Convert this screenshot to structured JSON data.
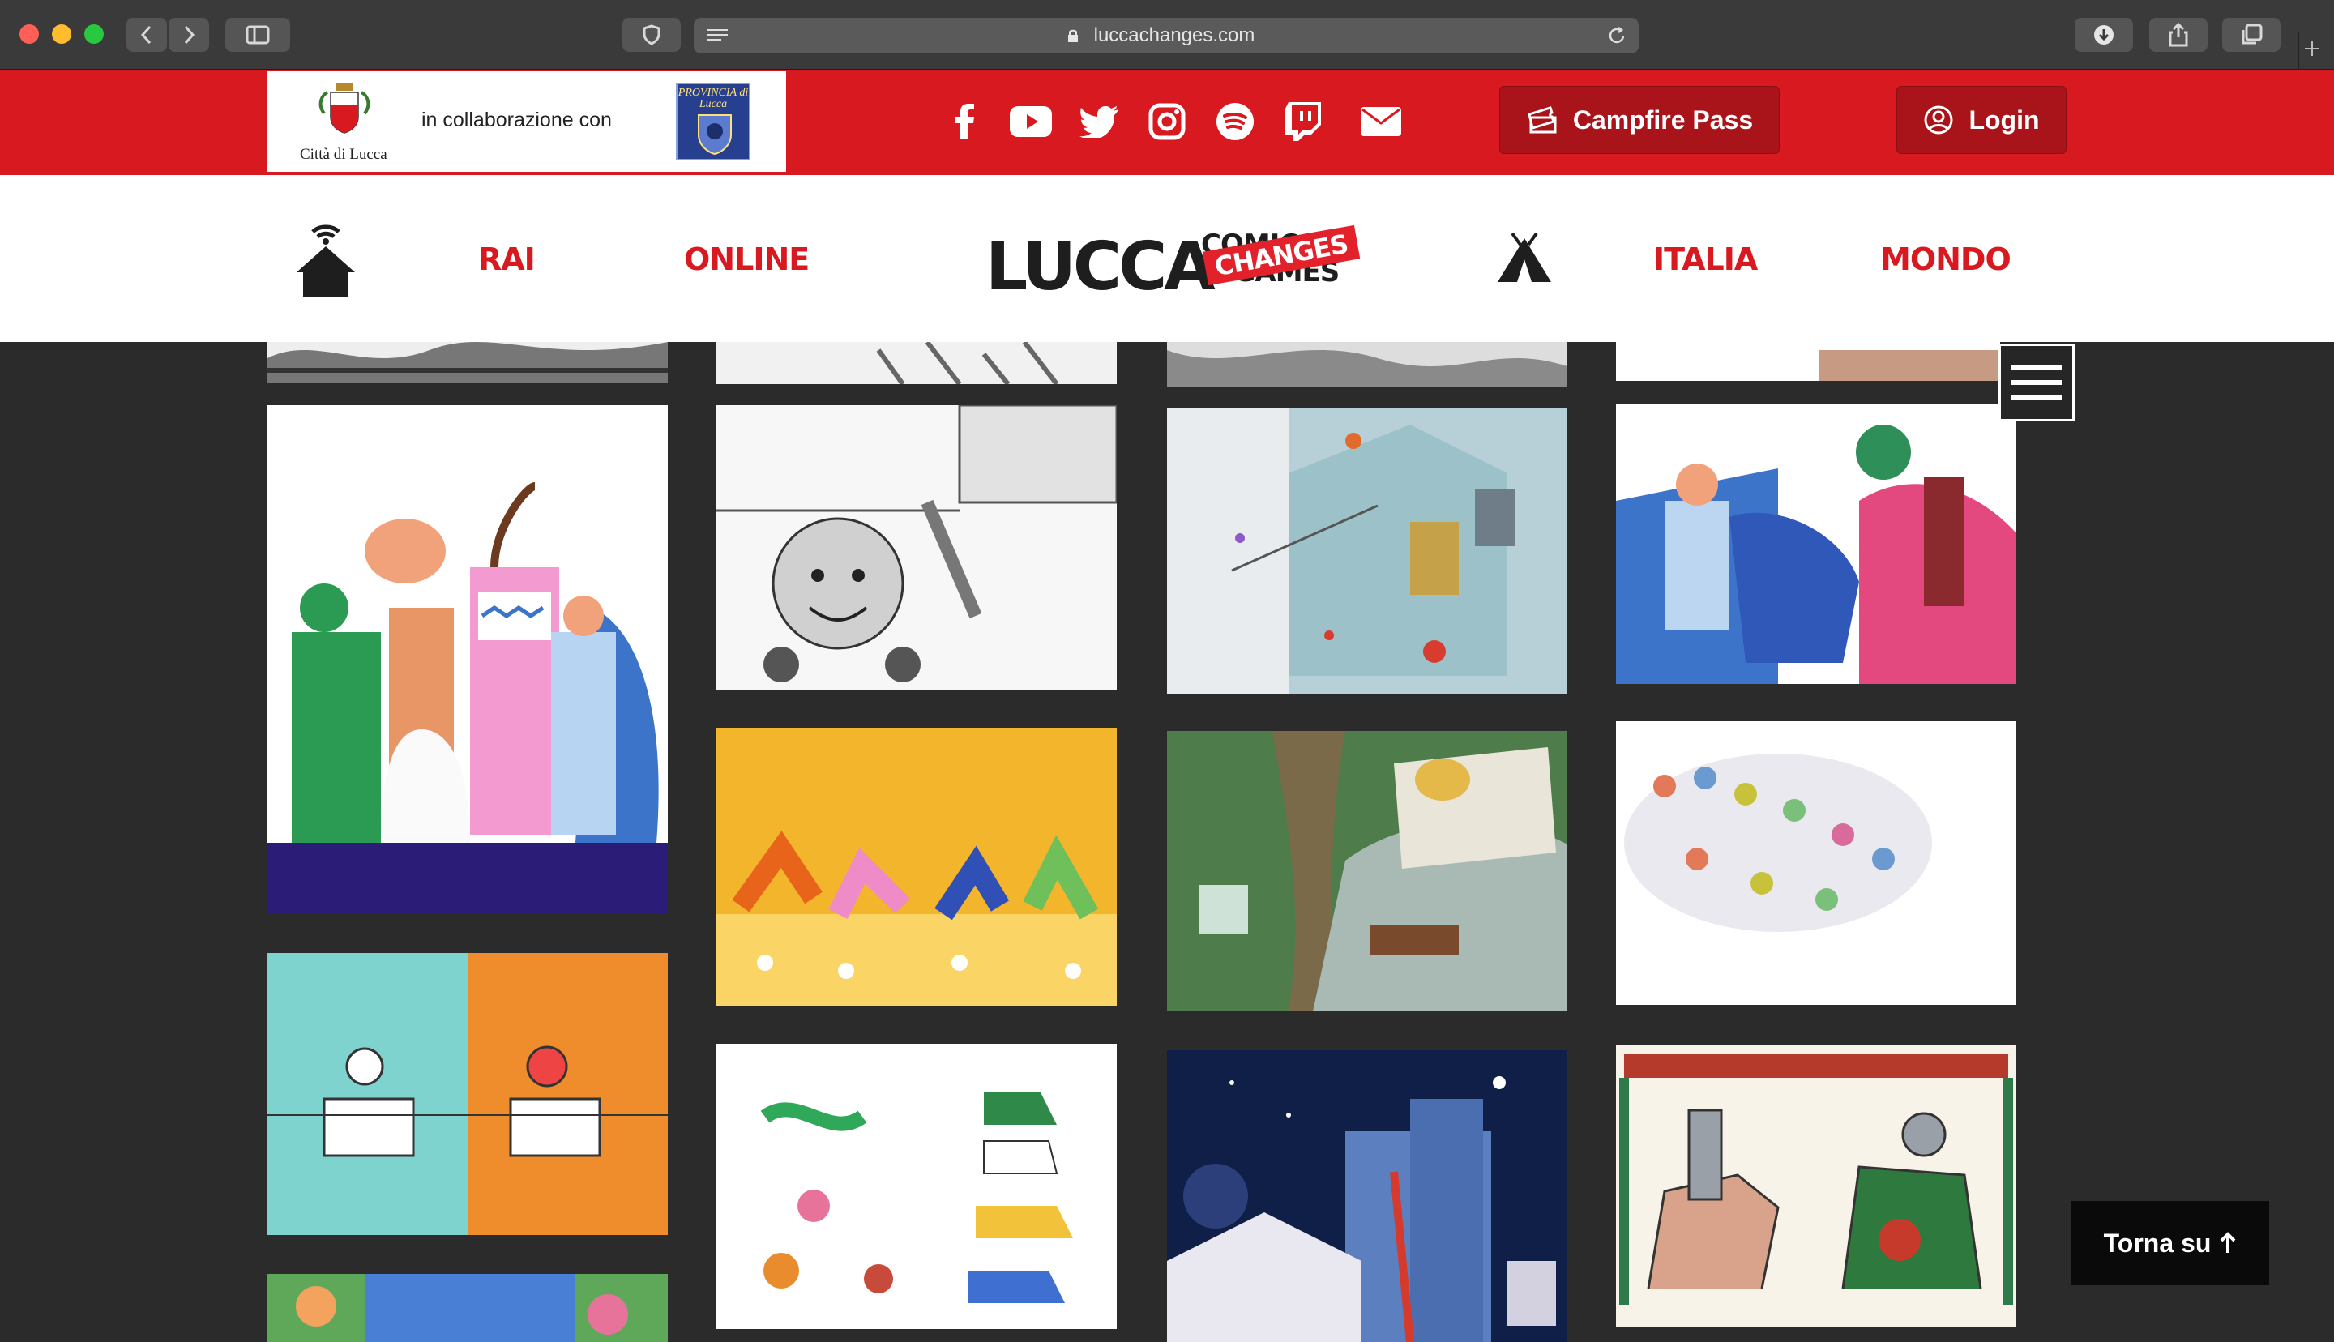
{
  "browser": {
    "url": "luccachanges.com"
  },
  "topbar": {
    "partner_city": "Città di Lucca",
    "partner_text": "in collaborazione con",
    "partner_province": "PROVINCIA di Lucca",
    "social": [
      "facebook-icon",
      "youtube-icon",
      "twitter-icon",
      "instagram-icon",
      "spotify-icon",
      "twitch-icon",
      "mail-icon"
    ],
    "campfire_label": "Campfire Pass",
    "login_label": "Login"
  },
  "nav": {
    "items": [
      "RAI",
      "ONLINE",
      "ITALIA",
      "MONDO"
    ],
    "logo_main": "LUCCA",
    "logo_comics": "COMICS",
    "logo_games": "& GAMES",
    "logo_changes": "CHANGES"
  },
  "back_to_top": "Torna su",
  "colors": {
    "brand_red": "#d81920",
    "dark_red": "#a8141a",
    "background": "#2b2b2b"
  }
}
